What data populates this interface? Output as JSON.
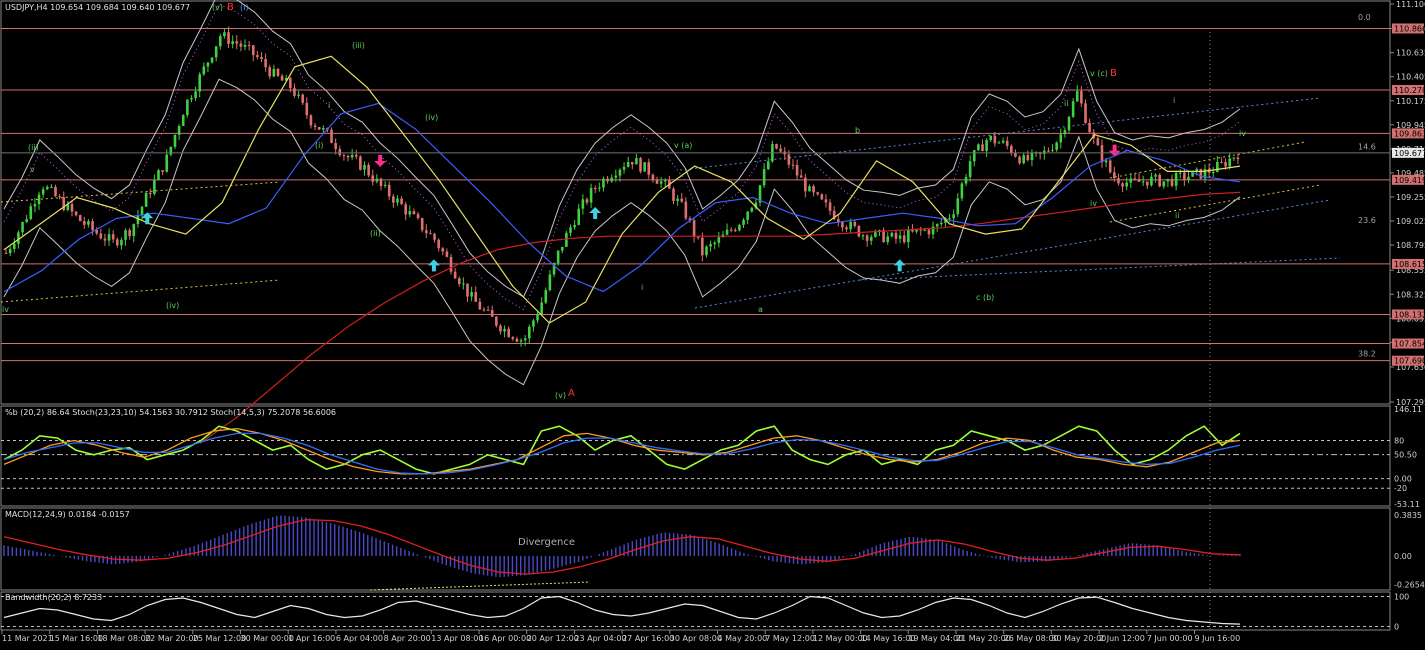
{
  "chart_data": {
    "type": "candlestick",
    "symbol_header": "USDJPY,H4  109.654 109.684 109.640 109.677",
    "main": {
      "ylim": [
        107.295,
        111.1
      ],
      "y_ticks": [
        "111.100",
        "110.866",
        "110.635",
        "110.405",
        "110.175",
        "109.945",
        "109.715",
        "109.485",
        "109.255",
        "109.025",
        "108.795",
        "108.555",
        "108.325",
        "108.095",
        "107.865",
        "107.630",
        "107.295"
      ],
      "price_levels": [
        {
          "value": 110.866,
          "label": "110.866"
        },
        {
          "value": 110.278,
          "label": "110.278"
        },
        {
          "value": 109.863,
          "label": "109.863"
        },
        {
          "value": 109.419,
          "label": "109.419"
        },
        {
          "value": 108.615,
          "label": "108.615"
        },
        {
          "value": 108.132,
          "label": "108.132"
        },
        {
          "value": 107.854,
          "label": "107.854"
        },
        {
          "value": 107.69,
          "label": "107.690"
        }
      ],
      "current_price": {
        "value": 109.677,
        "label": "109.677"
      },
      "fib_labels": [
        {
          "value": 110.92,
          "label": "0.0"
        },
        {
          "value": 109.68,
          "label": "14.6"
        },
        {
          "value": 108.98,
          "label": "23.6"
        },
        {
          "value": 107.7,
          "label": "38.2"
        }
      ],
      "closes": [
        108.72,
        109.02,
        109.38,
        109.22,
        109.05,
        108.92,
        108.82,
        108.95,
        109.3,
        109.62,
        110.12,
        110.45,
        110.8,
        110.72,
        110.6,
        110.42,
        110.3,
        110.0,
        109.85,
        109.65,
        109.55,
        109.35,
        109.2,
        109.02,
        108.85,
        108.58,
        108.3,
        108.12,
        107.98,
        107.88,
        108.25,
        108.75,
        109.1,
        109.35,
        109.5,
        109.62,
        109.5,
        109.35,
        109.12,
        108.72,
        108.85,
        109.0,
        109.25,
        109.75,
        109.55,
        109.3,
        109.15,
        109.0,
        108.9,
        108.88,
        108.85,
        108.92,
        108.95,
        109.1,
        109.6,
        109.82,
        109.75,
        109.6,
        109.65,
        109.82,
        110.25,
        109.75,
        109.45,
        109.38,
        109.42,
        109.4,
        109.45,
        109.48,
        109.55,
        109.677
      ],
      "series": [
        {
          "name": "ma-slow-red",
          "color": "#d02020",
          "values": [
            106.9,
            107.15,
            107.45,
            107.75,
            108.02,
            108.25,
            108.45,
            108.62,
            108.75,
            108.82,
            108.86,
            108.88,
            108.88,
            108.88,
            108.88,
            108.88,
            108.88,
            108.9,
            108.92,
            108.94,
            108.96,
            109.0,
            109.05,
            109.1,
            109.15,
            109.2,
            109.24,
            109.28,
            109.3
          ]
        },
        {
          "name": "ma-mid-blue",
          "color": "#3a5cff",
          "values": [
            108.35,
            108.55,
            108.85,
            109.05,
            109.1,
            109.05,
            109.0,
            109.15,
            109.65,
            110.05,
            110.15,
            109.9,
            109.55,
            109.2,
            108.82,
            108.5,
            108.35,
            108.6,
            108.95,
            109.2,
            109.25,
            109.1,
            109.0,
            109.05,
            109.1,
            109.05,
            108.98,
            109.0,
            109.25,
            109.55,
            109.7,
            109.6,
            109.45,
            109.4
          ]
        },
        {
          "name": "ma-fast-yellow",
          "color": "#e8e060",
          "values": [
            108.75,
            109.0,
            109.25,
            109.15,
            109.0,
            108.9,
            109.2,
            109.9,
            110.5,
            110.6,
            110.3,
            109.85,
            109.4,
            108.9,
            108.4,
            108.05,
            108.25,
            108.9,
            109.3,
            109.55,
            109.4,
            109.05,
            108.85,
            109.1,
            109.6,
            109.4,
            109.0,
            108.9,
            108.95,
            109.4,
            109.85,
            109.75,
            109.5,
            109.5,
            109.55
          ]
        }
      ],
      "arrows_up": [
        8,
        24,
        33,
        50,
        75
      ],
      "arrows_down": [
        21,
        62,
        82,
        101,
        111
      ],
      "wave_labels": [
        {
          "label": "(v)",
          "color": "#5ad05a"
        },
        {
          "label": "B",
          "color": "#ff3030"
        },
        {
          "label": "(I)",
          "color": "#6a8cff"
        },
        {
          "label": "(ii)",
          "color": "#5ad05a"
        },
        {
          "label": "v",
          "color": "#5ad05a"
        },
        {
          "label": "iv",
          "color": "#5ad05a"
        },
        {
          "label": "(iv)",
          "color": "#5ad05a"
        },
        {
          "label": "(i)",
          "color": "#5ad05a"
        },
        {
          "label": "(iii)",
          "color": "#5ad05a"
        },
        {
          "label": "(iv)",
          "color": "#5ad05a"
        },
        {
          "label": "(ii)",
          "color": "#5ad05a"
        },
        {
          "label": "i",
          "color": "#5ad05a"
        },
        {
          "label": "(v)",
          "color": "#5ad05a"
        },
        {
          "label": "A",
          "color": "#ff3030"
        },
        {
          "label": "i",
          "color": "#5ad05a"
        },
        {
          "label": "v (a)",
          "color": "#5ad05a"
        },
        {
          "label": "a",
          "color": "#5ad05a"
        },
        {
          "label": "b",
          "color": "#5ad05a"
        },
        {
          "label": "c (b)",
          "color": "#5ad05a"
        },
        {
          "label": "ii",
          "color": "#5ad05a"
        },
        {
          "label": "v (c)",
          "color": "#5ad05a"
        },
        {
          "label": "B",
          "color": "#ff3030"
        },
        {
          "label": "i",
          "color": "#5ad05a"
        },
        {
          "label": "iv",
          "color": "#5ad05a"
        },
        {
          "label": "ii",
          "color": "#5ad05a"
        },
        {
          "label": "iv",
          "color": "#5ad05a"
        }
      ]
    },
    "stoch": {
      "title": "%b (20,2) 86.64  Stoch(23,23,10) 54.1563 30.7912  Stoch(14,5,3) 75.2078 56.6006",
      "ylim": [
        -53.11,
        146.11
      ],
      "y_ticks": [
        "146.11",
        "80",
        "50.50",
        "0.00",
        "-20",
        "-53.11"
      ],
      "levels": [
        80,
        50.5,
        0,
        -20
      ],
      "series": [
        {
          "name": "percent-b",
          "color": "#a0ff30",
          "values": [
            40,
            60,
            90,
            85,
            60,
            50,
            60,
            65,
            40,
            50,
            60,
            80,
            110,
            100,
            80,
            60,
            70,
            40,
            20,
            30,
            50,
            60,
            40,
            20,
            10,
            20,
            30,
            50,
            40,
            30,
            100,
            110,
            90,
            60,
            80,
            90,
            60,
            30,
            20,
            40,
            60,
            70,
            100,
            110,
            60,
            40,
            30,
            50,
            60,
            30,
            40,
            30,
            60,
            70,
            100,
            90,
            80,
            60,
            70,
            90,
            110,
            100,
            60,
            30,
            40,
            60,
            90,
            110,
            70,
            95
          ]
        },
        {
          "name": "stoch-slow-orange",
          "color": "#ff9a20",
          "values": [
            30,
            50,
            70,
            80,
            70,
            55,
            45,
            60,
            85,
            100,
            105,
            95,
            80,
            60,
            40,
            25,
            15,
            10,
            10,
            15,
            20,
            30,
            40,
            65,
            90,
            95,
            85,
            70,
            60,
            55,
            50,
            55,
            70,
            85,
            90,
            80,
            65,
            50,
            40,
            35,
            40,
            55,
            75,
            85,
            80,
            60,
            45,
            40,
            30,
            25,
            35,
            55,
            75,
            80
          ]
        },
        {
          "name": "stoch-signal-blue",
          "color": "#3070ff",
          "values": [
            40,
            55,
            65,
            75,
            75,
            65,
            55,
            55,
            70,
            85,
            95,
            95,
            85,
            70,
            50,
            35,
            20,
            12,
            10,
            12,
            18,
            28,
            40,
            55,
            75,
            85,
            85,
            75,
            65,
            58,
            52,
            52,
            62,
            75,
            82,
            80,
            70,
            58,
            45,
            38,
            38,
            50,
            65,
            78,
            78,
            65,
            50,
            42,
            35,
            30,
            32,
            45,
            60,
            70
          ]
        }
      ]
    },
    "macd": {
      "title": "MACD(12,24,9) 0.0184 -0.0157",
      "ylim": [
        -0.3,
        0.42
      ],
      "y_ticks": [
        "0.3835",
        "0.00",
        "-0.2654"
      ],
      "annotation": "Divergence",
      "histogram": [
        0.1,
        0.05,
        0.0,
        -0.05,
        -0.08,
        -0.05,
        0.02,
        0.1,
        0.2,
        0.3,
        0.38,
        0.36,
        0.3,
        0.22,
        0.12,
        0.02,
        -0.08,
        -0.16,
        -0.2,
        -0.18,
        -0.12,
        -0.05,
        0.05,
        0.15,
        0.22,
        0.2,
        0.12,
        0.02,
        -0.05,
        -0.08,
        -0.06,
        0.02,
        0.12,
        0.18,
        0.15,
        0.05,
        -0.02,
        -0.06,
        -0.05,
        0.0,
        0.06,
        0.12,
        0.1,
        0.04,
        0.0,
        0.02
      ],
      "signal": [
        0.18,
        0.12,
        0.06,
        0.01,
        -0.03,
        -0.04,
        -0.02,
        0.03,
        0.1,
        0.19,
        0.28,
        0.34,
        0.33,
        0.28,
        0.2,
        0.1,
        0.0,
        -0.09,
        -0.15,
        -0.17,
        -0.15,
        -0.1,
        -0.03,
        0.06,
        0.14,
        0.18,
        0.16,
        0.09,
        0.02,
        -0.03,
        -0.05,
        -0.02,
        0.05,
        0.12,
        0.15,
        0.11,
        0.04,
        -0.02,
        -0.04,
        -0.02,
        0.03,
        0.08,
        0.09,
        0.06,
        0.02,
        0.01
      ]
    },
    "bandwidth": {
      "title": "Bandwidth(20,2) 8.7233",
      "ylim": [
        -5,
        105
      ],
      "y_ticks": [
        "100",
        "0"
      ],
      "levels": [
        100,
        0
      ],
      "values": [
        30,
        45,
        60,
        55,
        40,
        25,
        20,
        40,
        70,
        90,
        95,
        80,
        60,
        40,
        30,
        50,
        70,
        60,
        40,
        30,
        35,
        55,
        80,
        85,
        70,
        55,
        40,
        30,
        35,
        60,
        95,
        100,
        80,
        55,
        40,
        35,
        45,
        60,
        75,
        70,
        50,
        30,
        25,
        45,
        70,
        100,
        95,
        70,
        45,
        30,
        35,
        55,
        80,
        95,
        90,
        70,
        45,
        30,
        50,
        75,
        95,
        98,
        80,
        60,
        45,
        30,
        20,
        15,
        10,
        8
      ]
    },
    "x_labels": [
      "11 Mar 2021",
      "15 Mar 16:00",
      "18 Mar 08:00",
      "22 Mar 20:00",
      "25 Mar 12:00",
      "30 Mar 00:00",
      "1 Apr 16:00",
      "6 Apr 04:00",
      "8 Apr 20:00",
      "13 Apr 08:00",
      "16 Apr 00:00",
      "20 Apr 12:00",
      "23 Apr 04:00",
      "27 Apr 16:00",
      "30 Apr 08:00",
      "4 May 20:00",
      "7 May 12:00",
      "12 May 00:00",
      "14 May 16:00",
      "19 May 04:00",
      "21 May 20:00",
      "26 May 08:00",
      "30 May 20:00",
      "2 Jun 12:00",
      "7 Jun 00:00",
      "9 Jun 16:00"
    ]
  }
}
